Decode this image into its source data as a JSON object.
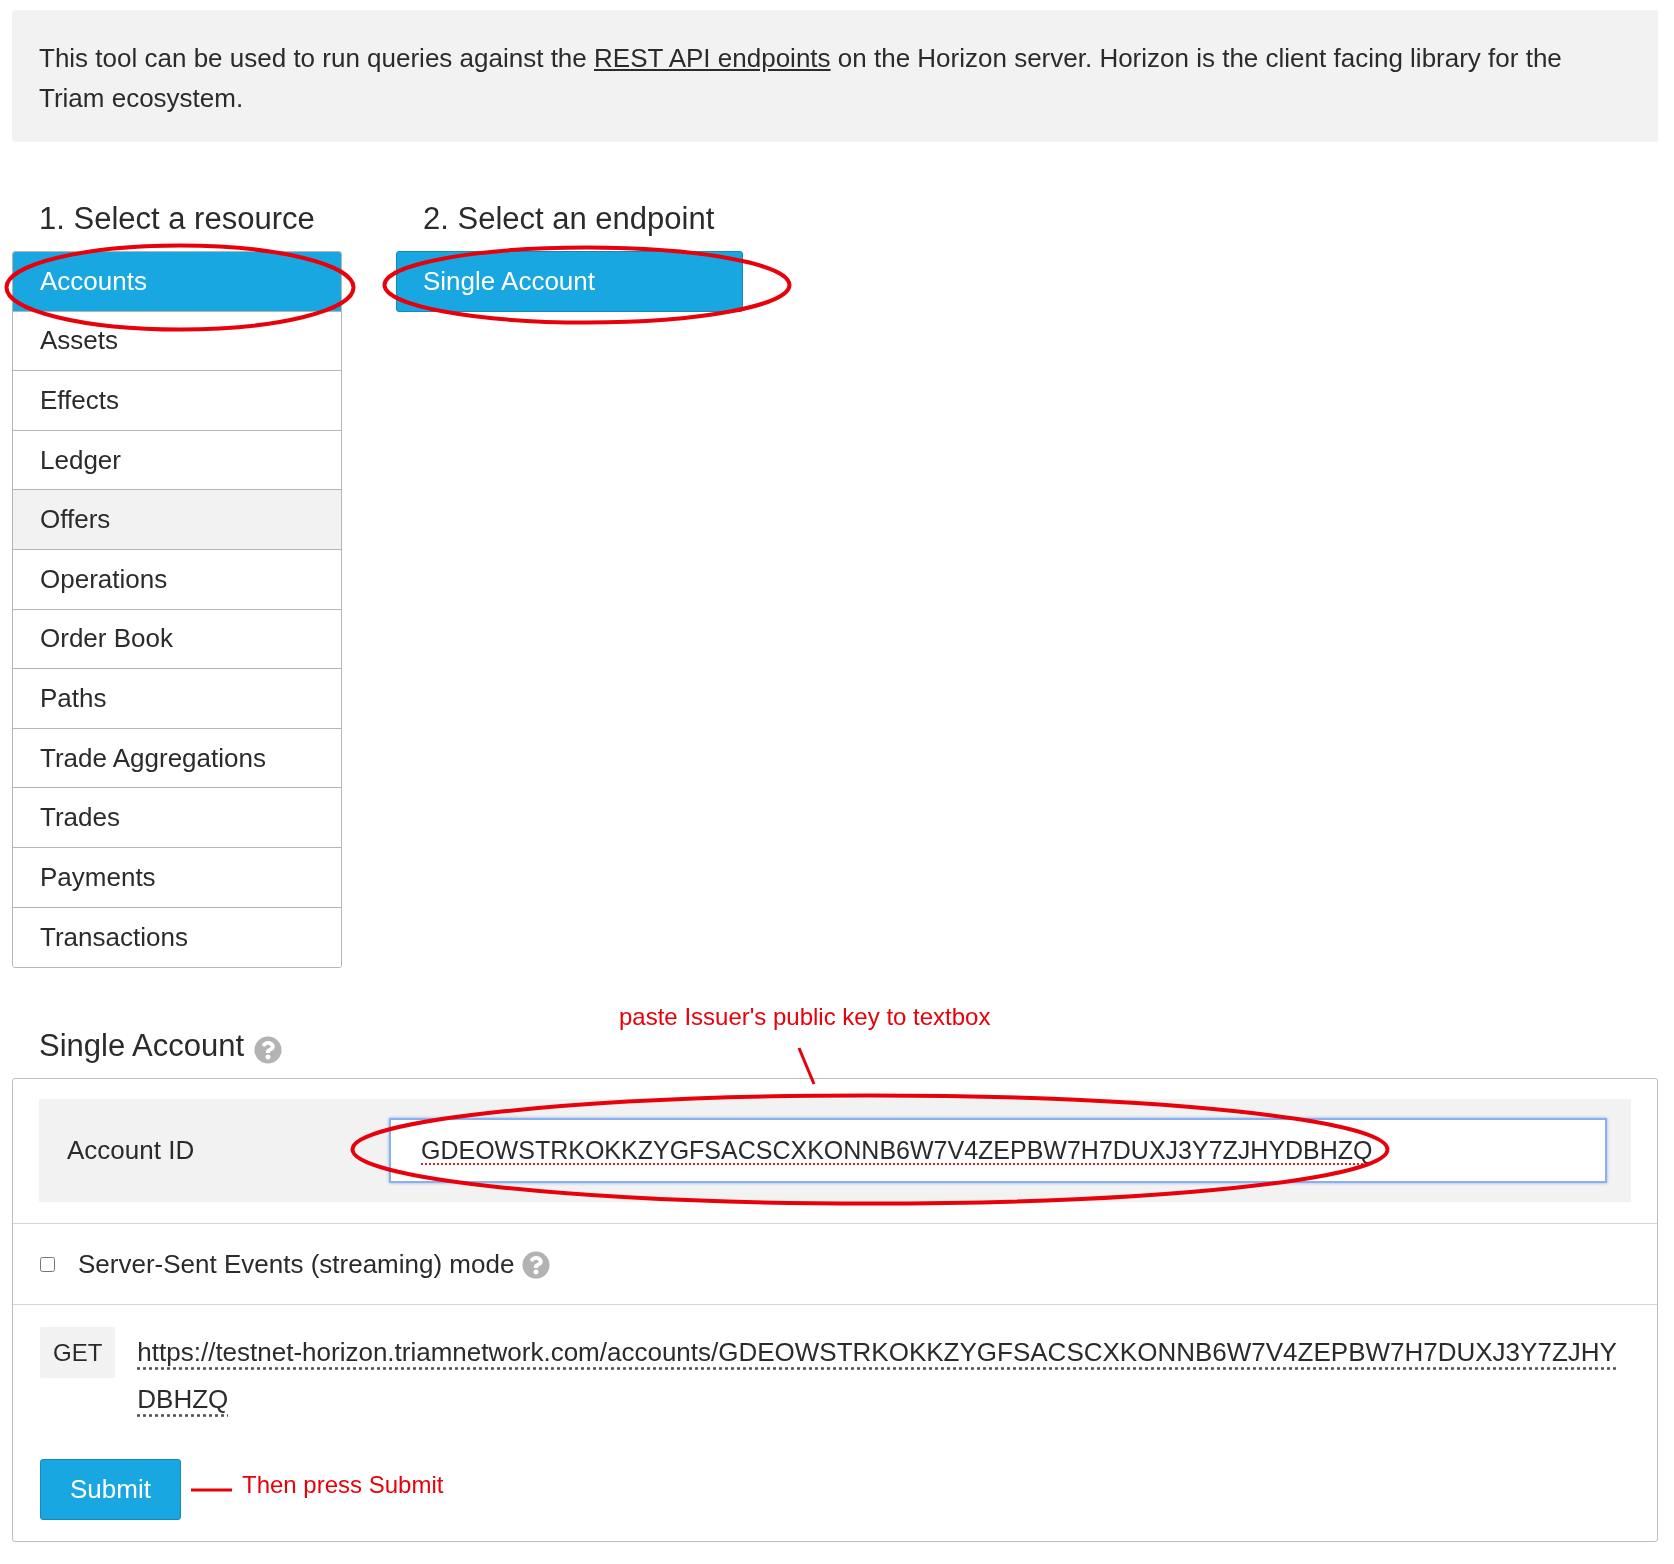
{
  "intro": {
    "before": "This tool can be used to run queries against the ",
    "link": "REST API endpoints",
    "after": " on the Horizon server. Horizon is the client facing library for the Triam ecosystem."
  },
  "resources": {
    "heading": "1. Select a resource",
    "items": [
      {
        "label": "Accounts",
        "selected": true,
        "hovered": false
      },
      {
        "label": "Assets",
        "selected": false,
        "hovered": false
      },
      {
        "label": "Effects",
        "selected": false,
        "hovered": false
      },
      {
        "label": "Ledger",
        "selected": false,
        "hovered": false
      },
      {
        "label": "Offers",
        "selected": false,
        "hovered": true
      },
      {
        "label": "Operations",
        "selected": false,
        "hovered": false
      },
      {
        "label": "Order Book",
        "selected": false,
        "hovered": false
      },
      {
        "label": "Paths",
        "selected": false,
        "hovered": false
      },
      {
        "label": "Trade Aggregations",
        "selected": false,
        "hovered": false
      },
      {
        "label": "Trades",
        "selected": false,
        "hovered": false
      },
      {
        "label": "Payments",
        "selected": false,
        "hovered": false
      },
      {
        "label": "Transactions",
        "selected": false,
        "hovered": false
      }
    ]
  },
  "endpoints": {
    "heading": "2. Select an endpoint",
    "items": [
      {
        "label": "Single Account",
        "selected": true
      }
    ]
  },
  "form": {
    "title": "Single Account",
    "fields": [
      {
        "label": "Account ID",
        "value": "GDEOWSTRKOKKZYGFSACSCXKONNB6W7V4ZEPBW7H7DUXJ3Y7ZJHYDBHZQ",
        "focused": true
      }
    ],
    "streaming": {
      "label": "Server-Sent Events (streaming) mode",
      "checked": false
    },
    "request": {
      "method": "GET",
      "url": "https://testnet-horizon.triamnetwork.com/accounts/GDEOWSTRKOKKZYGFSACSCXKONNB6W7V4ZEPBW7H7DUXJ3Y7ZJHYDBHZQ"
    },
    "submit": "Submit"
  },
  "annotations": {
    "paste_note": "paste Issuer's public key to textbox",
    "submit_note": "Then press Submit"
  }
}
